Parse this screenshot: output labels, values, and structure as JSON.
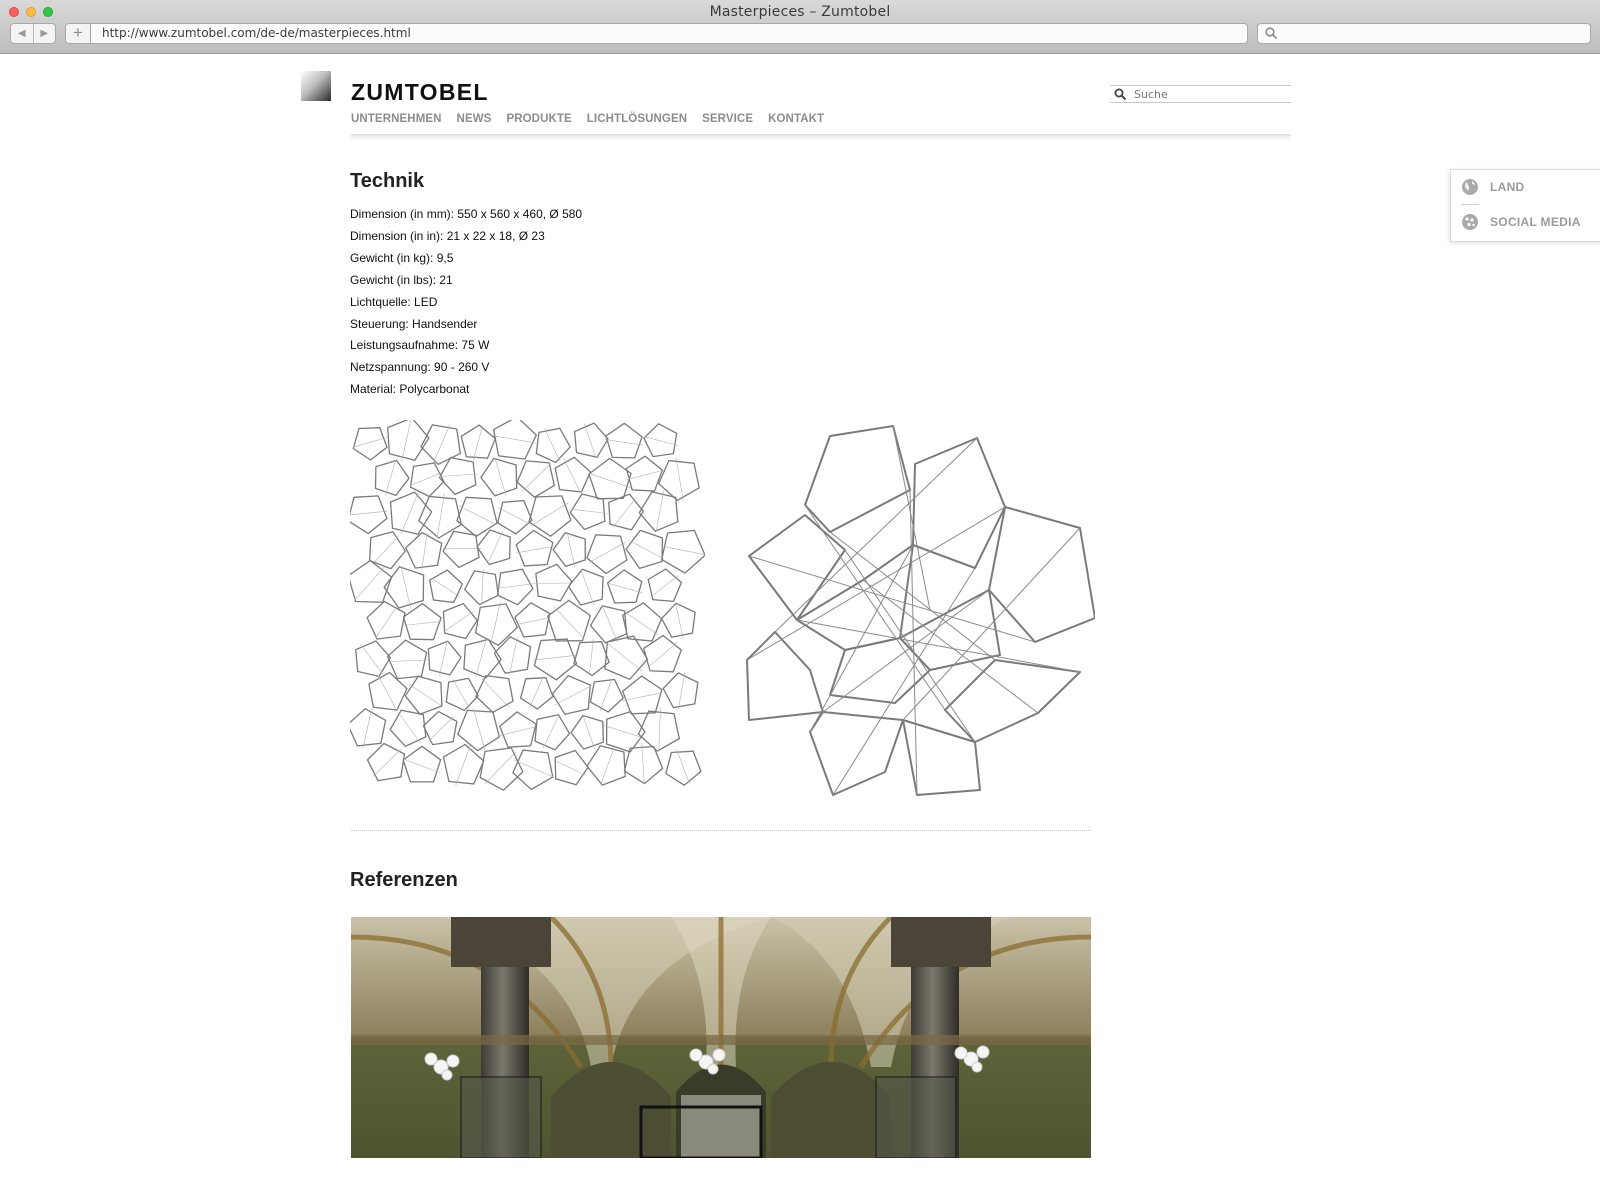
{
  "browser": {
    "window_title": "Masterpieces – Zumtobel",
    "url": "http://www.zumtobel.com/de-de/masterpieces.html",
    "new_tab_glyph": "+",
    "back_glyph": "◀",
    "forward_glyph": "▶"
  },
  "header": {
    "logo_text": "ZUMTOBEL",
    "nav": [
      "UNTERNEHMEN",
      "NEWS",
      "PRODUKTE",
      "LICHTLÖSUNGEN",
      "SERVICE",
      "KONTAKT"
    ],
    "search_placeholder": "Suche"
  },
  "sidepanel": {
    "land_label": "LAND",
    "social_label": "SOCIAL MEDIA",
    "land_icon": "globe-icon",
    "social_icon": "social-globe-icon"
  },
  "technik": {
    "title": "Technik",
    "specs": [
      "Dimension (in mm): 550 x 560 x 460, Ø 580",
      "Dimension (in in): 21 x 22 x 18, Ø 23",
      "Gewicht (in kg): 9,5",
      "Gewicht (in lbs): 21",
      "Lichtquelle: LED",
      "Steuerung: Handsender",
      "Leistungsaufnahme: 75 W",
      "Netzspannung: 90 - 260 V",
      "Material: Polycarbonat"
    ]
  },
  "referenzen": {
    "title": "Referenzen"
  },
  "colors": {
    "nav_text": "#8c8c8c",
    "drawing_stroke": "#7a7a7a",
    "heading": "#222222"
  }
}
